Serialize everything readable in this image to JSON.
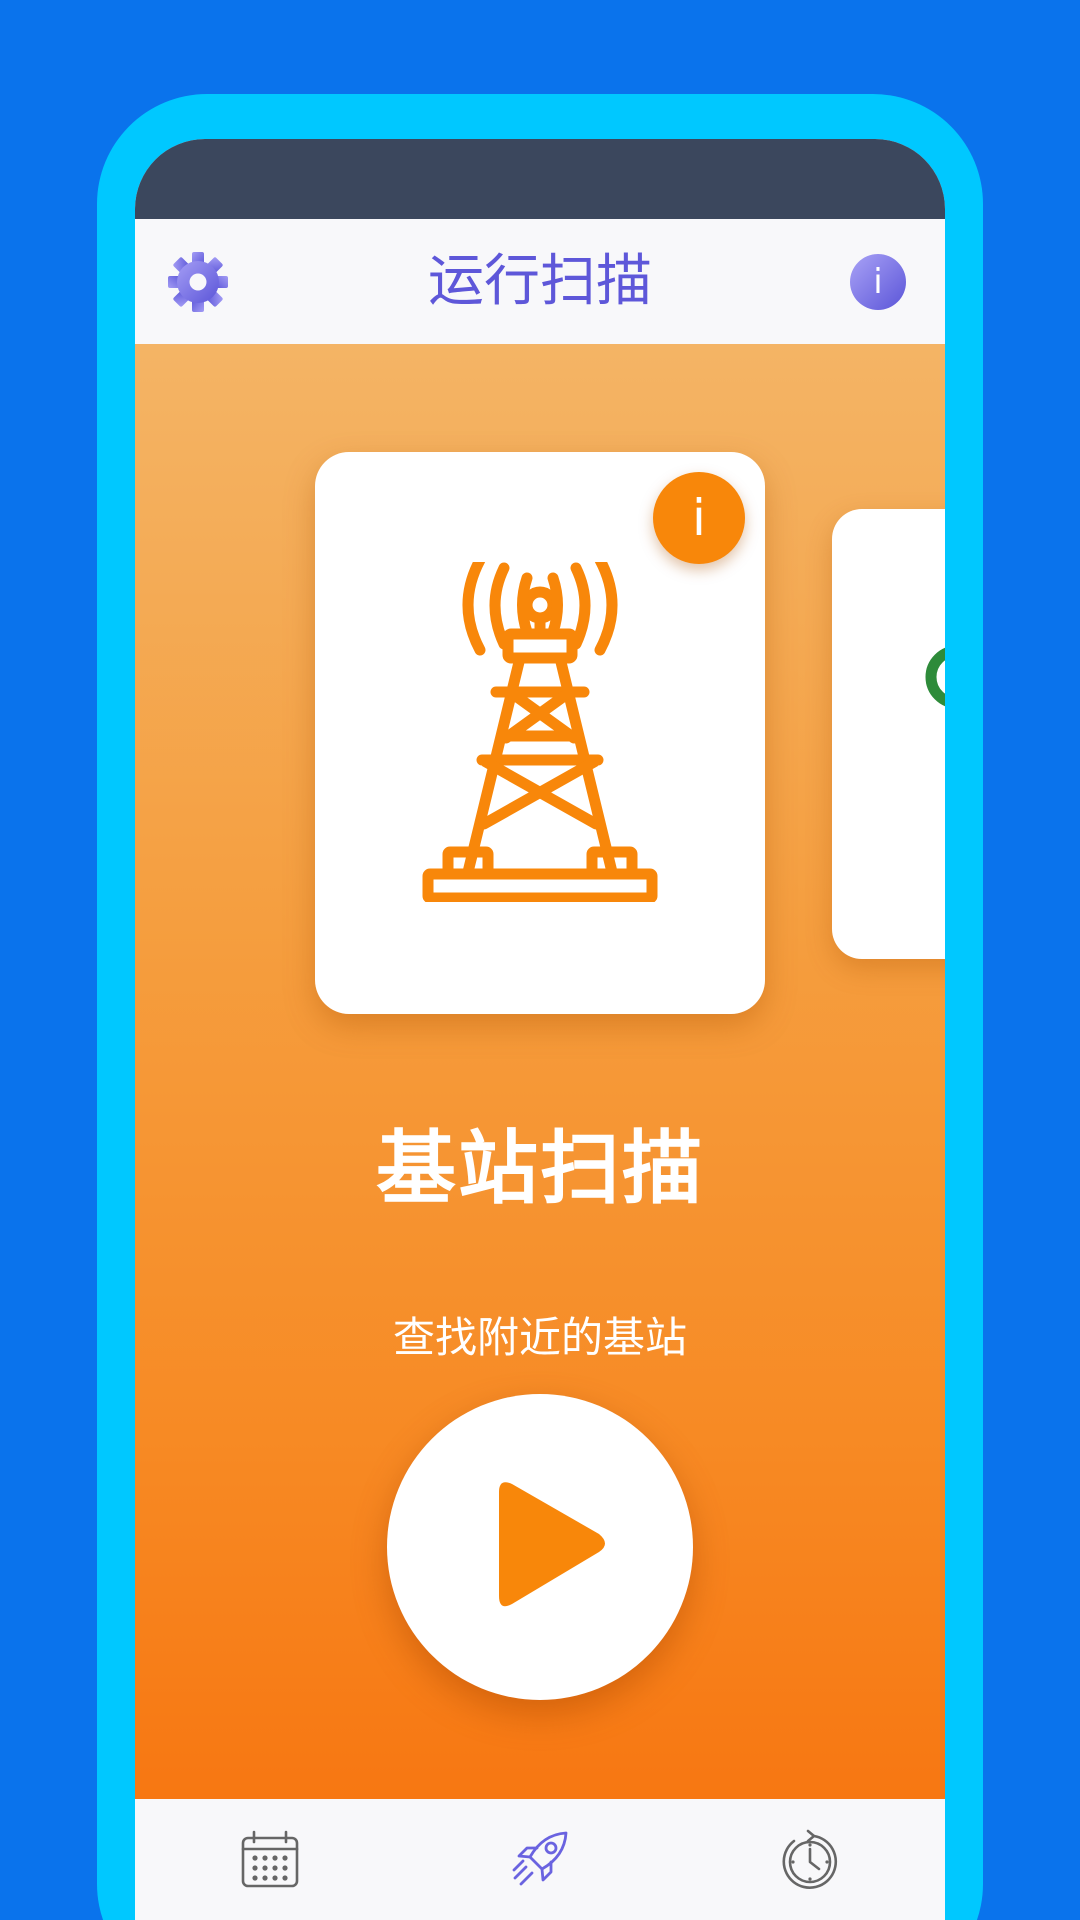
{
  "app_bar": {
    "title": "运行扫描",
    "settings_icon": "gear-icon",
    "info_icon": "info-icon",
    "info_glyph": "i"
  },
  "colors": {
    "background": "#0a73ec",
    "frame": "#00c8ff",
    "status_bar": "#3b475d",
    "accent_purple": "#5e57d9",
    "accent_orange": "#f8870a",
    "next_card_icon": "#2e8b3a"
  },
  "main_card": {
    "icon": "cell-tower-icon",
    "info_glyph": "i"
  },
  "scan": {
    "title": "基站扫描",
    "subtitle": "查找附近的基站",
    "play_icon": "play-icon"
  },
  "bottom_nav": {
    "items": [
      {
        "icon": "calendar-icon"
      },
      {
        "icon": "rocket-icon"
      },
      {
        "icon": "history-clock-icon"
      }
    ]
  }
}
